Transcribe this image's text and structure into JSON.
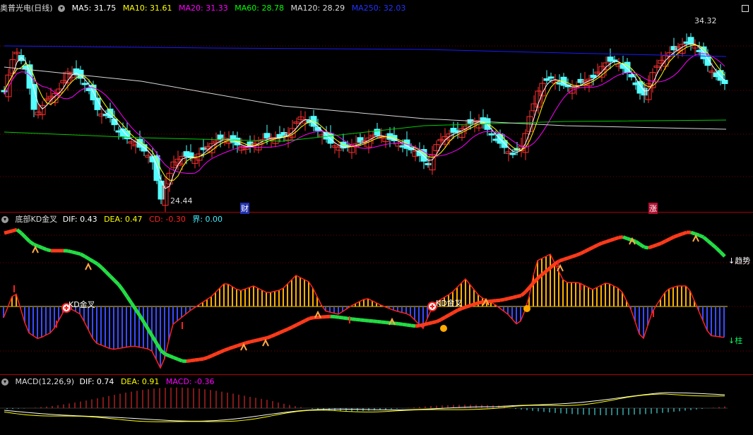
{
  "main": {
    "title": "奥普光电(日线)",
    "ma5": "MA5: 31.75",
    "ma10": "MA10: 31.61",
    "ma20": "MA20: 31.33",
    "ma60": "MA60: 28.78",
    "ma120": "MA120: 28.29",
    "ma250": "MA250: 32.03",
    "high_label": "34.32",
    "low_label": "24.44",
    "marker_cai": "财",
    "marker_zhang": "涨",
    "colors": {
      "ma5": "#ffffff",
      "ma10": "#ffff00",
      "ma20": "#ff00ff",
      "ma60": "#00ff00",
      "ma120": "#ffffff",
      "ma250": "#0000ff",
      "up": "#ff3030",
      "down": "#54ffff"
    }
  },
  "indicator": {
    "title": "底部KD金叉",
    "dif": "DIF: 0.43",
    "dea": "DEA: 0.47",
    "cd": "CD: -0.30",
    "jie": "界: 0.00",
    "cross_label_1": "KD金叉",
    "cross_label_2": "KD金叉",
    "trend_label": "↓趋势",
    "col_label": "↓柱"
  },
  "macd": {
    "title": "MACD(12,26,9)",
    "dif": "DIF: 0.74",
    "dea": "DEA: 0.91",
    "macd": "MACD: -0.36"
  }
}
